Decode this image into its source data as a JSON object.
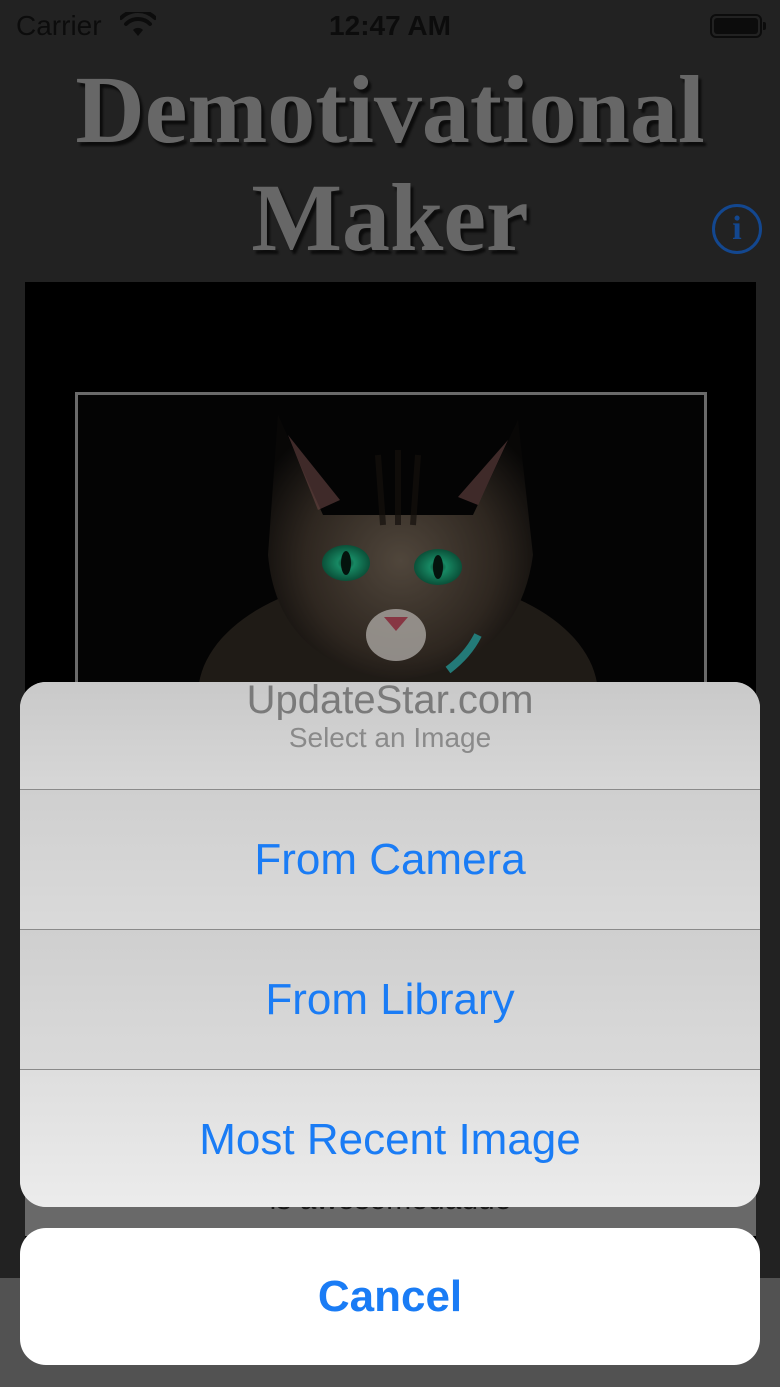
{
  "status_bar": {
    "carrier": "Carrier",
    "time": "12:47 AM",
    "wifi_icon": "wifi-icon",
    "battery_icon": "battery-icon"
  },
  "app": {
    "title_line1": "Demotivational",
    "title_line2": "Maker",
    "info_glyph": "i"
  },
  "poster": {
    "image": "cat-photo",
    "caption_partial": "is awesomeuadue"
  },
  "action_sheet": {
    "watermark": "UpdateStar.com",
    "title": "Select an Image",
    "options": [
      {
        "label": "From Camera"
      },
      {
        "label": "From Library"
      },
      {
        "label": "Most Recent Image"
      }
    ],
    "cancel_label": "Cancel"
  },
  "colors": {
    "accent": "#1a7cf5",
    "info_blue": "#1a5fbf",
    "title_gray": "#8a8a8a",
    "background": "#2e2e2e"
  }
}
